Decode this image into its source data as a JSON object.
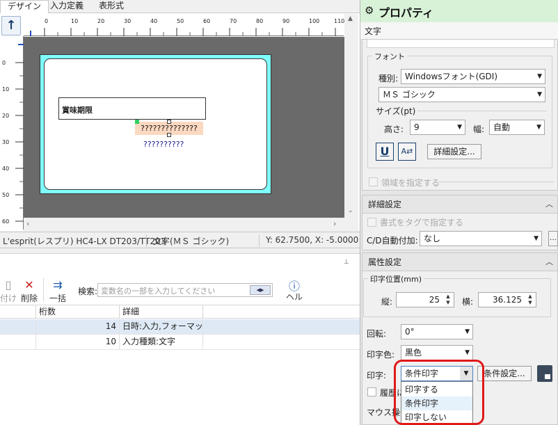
{
  "tabs": [
    "デザイン",
    "入力定義",
    "表形式"
  ],
  "designer": {
    "ruler_top": [
      "0",
      "10",
      "20",
      "30",
      "40",
      "50",
      "60",
      "70",
      "80",
      "90",
      "100",
      "110"
    ],
    "ruler_left": [
      "0",
      "10",
      "20",
      "30",
      "40",
      "50",
      "60"
    ],
    "field_label": "賞味期限",
    "selected_text": "??????????????",
    "second_text": "??????????"
  },
  "status": {
    "printer": "L'esprit(レスプリ) HC4-LX DT203/TT203",
    "object": "文字(ＭＳ ゴシック)",
    "coords": "Y: 62.7500, X: -5.0000"
  },
  "toolbar": {
    "partial_label": "付け",
    "delete": "削除",
    "bulk": "一括",
    "search_label": "検索:",
    "search_placeholder": "変数名の一部を入力してください",
    "help": "ヘルプ"
  },
  "table": {
    "headers": [
      "桁数",
      "詳細"
    ],
    "rows": [
      {
        "digits": "14",
        "detail": "日時:入力,フォーマット..."
      },
      {
        "digits": "10",
        "detail": "入力種類:文字"
      }
    ]
  },
  "props": {
    "title": "プロパティ",
    "subtitle": "文字",
    "font_group": "フォント",
    "kind_label": "種別:",
    "kind_value": "Windowsフォント(GDI)",
    "font_value": "ＭＳ ゴシック",
    "size_group": "サイズ(pt)",
    "height_label": "高さ:",
    "height_value": "9",
    "width_label": "幅:",
    "width_value": "自動",
    "detail_btn": "詳細設定...",
    "area_label": "領域を指定する",
    "details_section": "詳細設定",
    "tag_label": "書式をタグで指定する",
    "cd_label": "C/D自動付加:",
    "cd_value": "なし",
    "attr_section": "属性設定",
    "position_group": "印字位置(mm)",
    "vert_label": "縦:",
    "vert_value": "25",
    "horiz_label": "横:",
    "horiz_value": "36.125",
    "rotation_label": "回転:",
    "rotation_value": "0°",
    "color_label": "印字色:",
    "color_value": "黒色",
    "print_label": "印字:",
    "print_value": "条件印字",
    "cond_btn": "条件設定...",
    "history_label": "履歴に",
    "mouse_label": "マウス操作",
    "print_options": [
      "印字する",
      "条件印字",
      "印字しない"
    ]
  },
  "colors": {
    "label_border": "#80ffff",
    "selection": "#fbd8c0",
    "panel_title_bg": "#d8f2d8",
    "highlight_ring": "#e01818"
  }
}
